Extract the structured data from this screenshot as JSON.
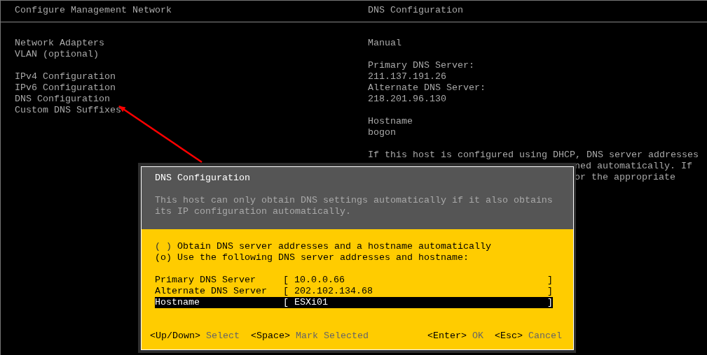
{
  "left_panel": {
    "title": "Configure Management Network",
    "groups": [
      [
        "Network Adapters",
        "VLAN (optional)"
      ],
      [
        "IPv4 Configuration",
        "IPv6 Configuration",
        "DNS Configuration",
        "Custom DNS Suffixes"
      ]
    ]
  },
  "right_panel": {
    "title": "DNS Configuration",
    "groups": [
      [
        "Manual"
      ],
      [
        "Primary DNS Server:",
        "211.137.191.26",
        "Alternate DNS Server:",
        "218.201.96.130"
      ],
      [
        "Hostname",
        "bogon"
      ]
    ],
    "note_lines": [
      "If this host is configured using DHCP, DNS server addresses",
      "ned automatically. If",
      "or the appropriate"
    ]
  },
  "dialog": {
    "title": "DNS Configuration",
    "description": [
      "This host can only obtain DNS settings automatically if it also obtains",
      "its IP configuration automatically."
    ],
    "options": [
      {
        "marker": "( )",
        "label": "Obtain DNS server addresses and a hostname automatically",
        "selected": false
      },
      {
        "marker": "(o)",
        "label": "Use the following DNS server addresses and hostname:",
        "selected": true
      }
    ],
    "fields": [
      {
        "label": "Primary DNS Server",
        "brackets": [
          "[",
          "]"
        ],
        "value": "10.0.0.66",
        "selected": false
      },
      {
        "label": "Alternate DNS Server",
        "brackets": [
          "[",
          "]"
        ],
        "value": "202.102.134.68",
        "selected": false
      },
      {
        "label": "Hostname",
        "brackets": [
          "[",
          "]"
        ],
        "value": "ESXi01",
        "selected": true
      }
    ],
    "footer_left": [
      {
        "key": "<Up/Down>",
        "action": "Select"
      },
      {
        "key": "<Space>",
        "action": "Mark Selected"
      }
    ],
    "footer_right": [
      {
        "key": "<Enter>",
        "action": "OK"
      },
      {
        "key": "<Esc>",
        "action": "Cancel"
      }
    ]
  }
}
